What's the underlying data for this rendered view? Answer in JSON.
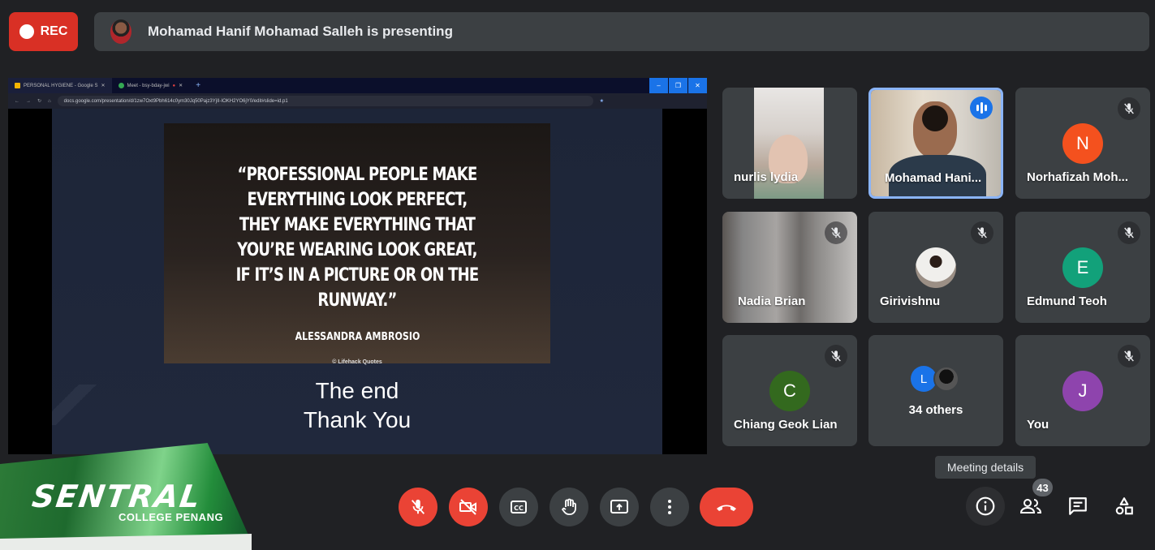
{
  "topbar": {
    "rec_label": "REC",
    "presenting_text": "Mohamad Hanif Mohamad Salleh is presenting"
  },
  "presentation": {
    "browser_tabs": [
      "PERSONAL HYGIENE - Google S",
      "Meet - bsy-bday-jwi"
    ],
    "url": "docs.google.com/presentation/d/1zw7Oxt9Pbh614c0ym30Jq50Pajz3YjII-IOKH2YO6jY0/edit#slide=id.p1",
    "quote_text": "“PROFESSIONAL PEOPLE MAKE EVERYTHING LOOK PERFECT, THEY MAKE EVERYTHING THAT YOU’RE WEARING LOOK GREAT, IF IT’S IN A PICTURE OR ON THE RUNWAY.”",
    "quote_author": "ALESSANDRA AMBROSIO",
    "quote_brand": "Lifehack Quotes",
    "end_line1": "The end",
    "end_line2": "Thank You"
  },
  "participants": [
    {
      "name": "nurlis lydia",
      "kind": "video"
    },
    {
      "name": "Mohamad Hani...",
      "kind": "video",
      "speaking": true
    },
    {
      "name": "Norhafizah Moh...",
      "initial": "N",
      "color": "#f4511e",
      "muted": true
    },
    {
      "name": "Nadia Brian",
      "kind": "video",
      "muted": true
    },
    {
      "name": "Girivishnu",
      "kind": "photo",
      "muted": true
    },
    {
      "name": "Edmund Teoh",
      "initial": "E",
      "color": "#12a17a",
      "muted": true
    },
    {
      "name": "Chiang Geok Lian",
      "initial": "C",
      "color": "#33691e",
      "muted": true
    },
    {
      "name": "34 others",
      "initial": "L",
      "color": "#1a73e8"
    },
    {
      "name": "You",
      "initial": "J",
      "color": "#8e44ad",
      "muted": true
    }
  ],
  "tooltip": "Meeting details",
  "people_count": "43",
  "logo": {
    "main": "SENTRAL",
    "sub": "COLLEGE PENANG"
  }
}
